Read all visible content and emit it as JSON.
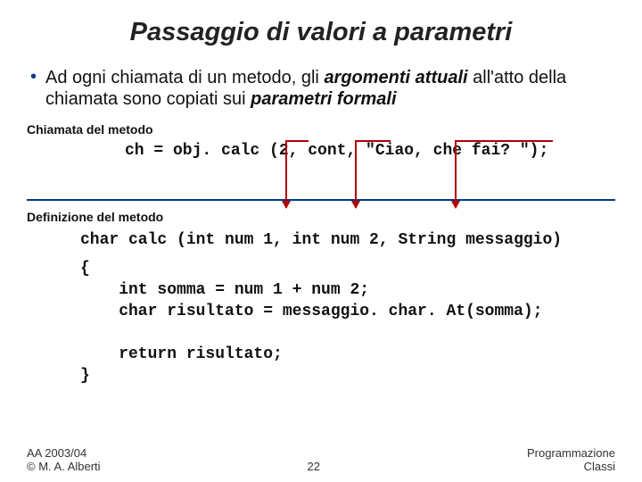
{
  "title": "Passaggio di valori a parametri",
  "bullet": {
    "pre": "Ad ogni chiamata di un metodo, gli ",
    "em1": "argomenti attuali",
    "mid": " all'atto della chiamata sono copiati sui ",
    "em2": "parametri formali"
  },
  "labels": {
    "call": "Chiamata del metodo",
    "def": "Definizione del metodo"
  },
  "code": {
    "call_line": "ch = obj. calc (2, cont, \"Ciao, che fai? \");",
    "def_sig": "char calc (int num 1, int num 2, String messaggio)",
    "def_body": "{\n    int somma = num 1 + num 2;\n    char risultato = messaggio. char. At(somma);\n\n    return risultato;\n}"
  },
  "footer": {
    "left1": "AA 2003/04",
    "left2": "© M. A. Alberti",
    "page": "22",
    "right1": "Programmazione",
    "right2": "Classi"
  }
}
